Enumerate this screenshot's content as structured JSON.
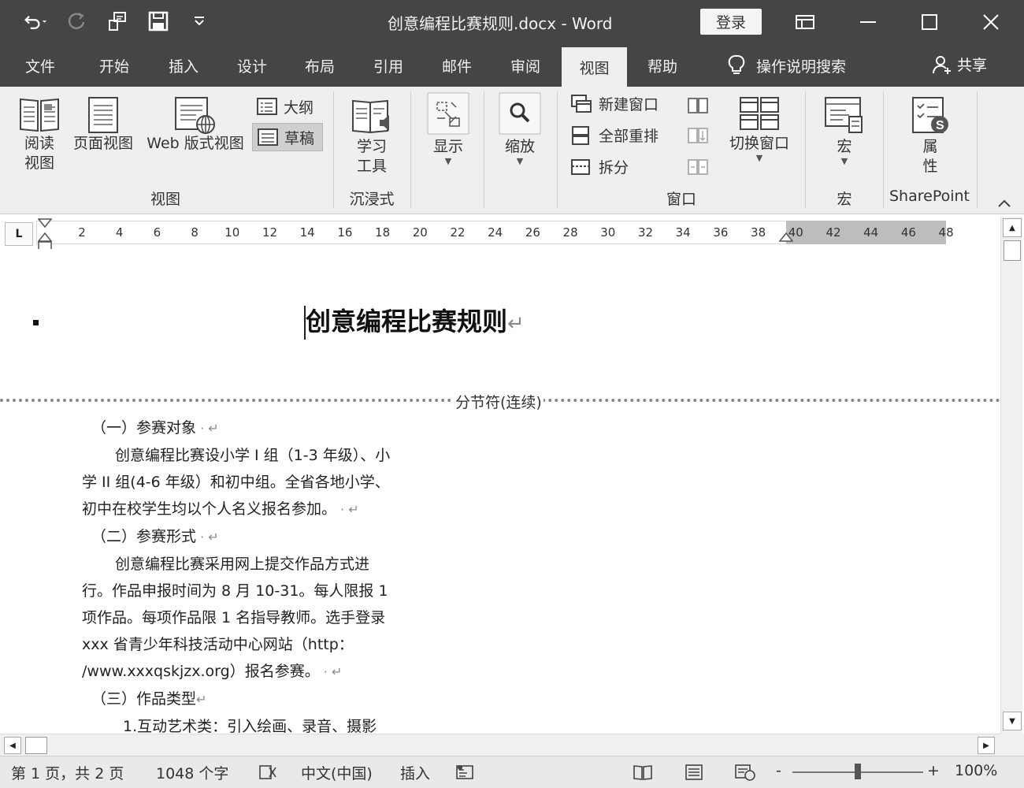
{
  "titlebar": {
    "title": "创意编程比赛规则.docx  -  Word",
    "login_label": "登录",
    "qat_icons": [
      "undo-icon",
      "redo-icon",
      "touch-mode-icon",
      "save-icon",
      "customize-icon"
    ]
  },
  "tabs": [
    {
      "label": "文件"
    },
    {
      "label": "开始"
    },
    {
      "label": "插入"
    },
    {
      "label": "设计"
    },
    {
      "label": "布局"
    },
    {
      "label": "引用"
    },
    {
      "label": "邮件"
    },
    {
      "label": "审阅"
    },
    {
      "label": "视图",
      "active": true
    },
    {
      "label": "帮助"
    }
  ],
  "tell_me": "操作说明搜索",
  "share_label": "共享",
  "ribbon": {
    "views": {
      "read_mode_line1": "阅读",
      "read_mode_line2": "视图",
      "print_layout": "页面视图",
      "web_layout": "Web 版式视图",
      "outline": "大纲",
      "draft": "草稿",
      "group_label": "视图"
    },
    "immersive": {
      "learning_line1": "学习",
      "learning_line2": "工具",
      "group_label": "沉浸式"
    },
    "show": {
      "label": "显示"
    },
    "zoom": {
      "label": "缩放"
    },
    "window": {
      "new_window": "新建窗口",
      "arrange_all": "全部重排",
      "split": "拆分",
      "switch_windows": "切换窗口",
      "group_label": "窗口"
    },
    "macros": {
      "label": "宏",
      "group_label": "宏"
    },
    "sharepoint": {
      "line1": "属",
      "line2": "性",
      "group_label": "SharePoint"
    }
  },
  "ruler": {
    "corner": "L",
    "numbers": [
      "2",
      "4",
      "6",
      "8",
      "10",
      "12",
      "14",
      "16",
      "18",
      "20",
      "22",
      "24",
      "26",
      "28",
      "30",
      "32",
      "34",
      "36",
      "38",
      "40",
      "42",
      "44",
      "46",
      "48"
    ]
  },
  "document": {
    "heading": "创意编程比赛规则",
    "section_break": "分节符(连续)",
    "lines": [
      "（一）参赛对象",
      "创意编程比赛设小学 I 组（1-3 年级）、小",
      "学 II 组(4-6 年级）和初中组。全省各地小学、",
      "初中在校学生均以个人名义报名参加。",
      "（二）参赛形式",
      "创意编程比赛采用网上提交作品方式进",
      "行。作品申报时间为 8 月 10-31。每人限报 1",
      "项作品。每项作品限 1 名指导教师。选手登录",
      "xxx 省青少年科技活动中心网站（http：",
      "/www.xxxqskjzx.org）报名参赛。",
      "（三）作品类型",
      "1.互动艺术类：引入绘画、录音、摄影"
    ]
  },
  "statusbar": {
    "page": "第 1 页，共 2 页",
    "words": "1048 个字",
    "language": "中文(中国)",
    "mode": "插入",
    "zoom": "100%"
  }
}
